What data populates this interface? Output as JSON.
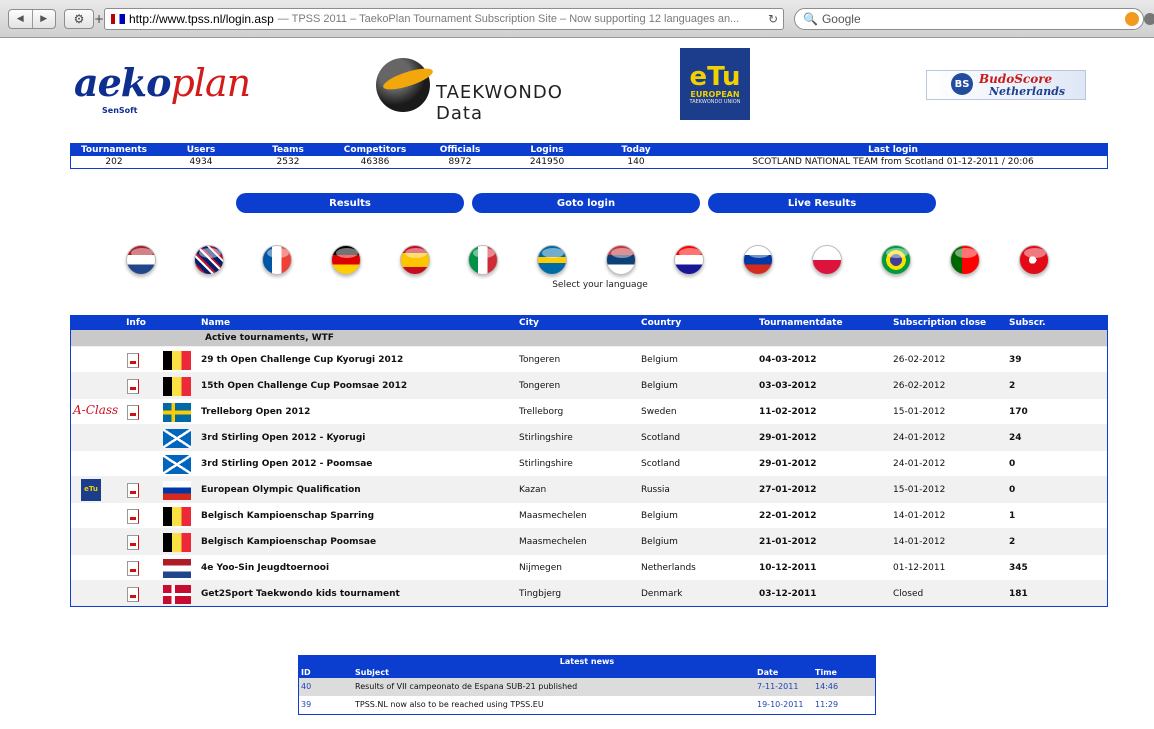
{
  "browser": {
    "url": "http://www.tpss.nl/login.asp",
    "page_title": "— TPSS 2011 – TaekoPlan Tournament Subscription Site – Now supporting 12 languages an...",
    "search_placeholder": "Google",
    "reload_icon": "reload-icon"
  },
  "logos": {
    "taekoplan_main": "aeko",
    "taekoplan_plan": "plan",
    "taekoplan_sub": "SenSoft",
    "taekwondo_data": "TAEKWONDO Data",
    "etu_big": "eTu",
    "etu_small": "EUROPEAN",
    "etu_tiny": "TAEKWONDO UNION",
    "budoscore_mark": "BS",
    "budoscore_name": "BudoScore",
    "budoscore_country": "Netherlands"
  },
  "stats": {
    "headers": [
      "Tournaments",
      "Users",
      "Teams",
      "Competitors",
      "Officials",
      "Logins",
      "Today",
      "Last login"
    ],
    "values": [
      "202",
      "4934",
      "2532",
      "46386",
      "8972",
      "241950",
      "140",
      "SCOTLAND NATIONAL TEAM from Scotland 01-12-2011 / 20:06"
    ]
  },
  "buttons": {
    "results": "Results",
    "goto_login": "Goto login",
    "live_results": "Live Results"
  },
  "languages": {
    "caption": "Select your language",
    "flags": [
      "netherlands",
      "united-kingdom",
      "france",
      "germany",
      "spain",
      "italy",
      "sweden",
      "serbia",
      "croatia",
      "russia",
      "poland",
      "brazil",
      "portugal",
      "turkey"
    ]
  },
  "tournaments": {
    "headers": {
      "info": "Info",
      "name": "Name",
      "city": "City",
      "country": "Country",
      "date": "Tournamentdate",
      "close": "Subscription close",
      "subscr": "Subscr."
    },
    "section": "Active tournaments, WTF",
    "a_class": "A-Class",
    "etu_mini": "eTu",
    "rows": [
      {
        "name": "29 th Open Challenge Cup Kyorugi 2012",
        "city": "Tongeren",
        "country": "Belgium",
        "date": "04-03-2012",
        "close": "26-02-2012",
        "subscr": "39",
        "flag": "belgium"
      },
      {
        "name": "15th Open Challenge Cup Poomsae 2012",
        "city": "Tongeren",
        "country": "Belgium",
        "date": "03-03-2012",
        "close": "26-02-2012",
        "subscr": "2",
        "flag": "belgium"
      },
      {
        "name": "Trelleborg Open 2012",
        "city": "Trelleborg",
        "country": "Sweden",
        "date": "11-02-2012",
        "close": "15-01-2012",
        "subscr": "170",
        "flag": "sweden"
      },
      {
        "name": "3rd Stirling Open 2012 - Kyorugi",
        "city": "Stirlingshire",
        "country": "Scotland",
        "date": "29-01-2012",
        "close": "24-01-2012",
        "subscr": "24",
        "flag": "scotland"
      },
      {
        "name": "3rd Stirling Open 2012 - Poomsae",
        "city": "Stirlingshire",
        "country": "Scotland",
        "date": "29-01-2012",
        "close": "24-01-2012",
        "subscr": "0",
        "flag": "scotland"
      },
      {
        "name": "European Olympic Qualification",
        "city": "Kazan",
        "country": "Russia",
        "date": "27-01-2012",
        "close": "15-01-2012",
        "subscr": "0",
        "flag": "russia"
      },
      {
        "name": "Belgisch Kampioenschap Sparring",
        "city": "Maasmechelen",
        "country": "Belgium",
        "date": "22-01-2012",
        "close": "14-01-2012",
        "subscr": "1",
        "flag": "belgium"
      },
      {
        "name": "Belgisch Kampioenschap Poomsae",
        "city": "Maasmechelen",
        "country": "Belgium",
        "date": "21-01-2012",
        "close": "14-01-2012",
        "subscr": "2",
        "flag": "belgium"
      },
      {
        "name": "4e Yoo-Sin Jeugdtoernooi",
        "city": "Nijmegen",
        "country": "Netherlands",
        "date": "10-12-2011",
        "close": "01-12-2011",
        "subscr": "345",
        "flag": "netherlands"
      },
      {
        "name": "Get2Sport Taekwondo kids tournament",
        "city": "Tingbjerg",
        "country": "Denmark",
        "date": "03-12-2011",
        "close": "Closed",
        "subscr": "181",
        "flag": "denmark"
      }
    ]
  },
  "news": {
    "title": "Latest news",
    "headers": {
      "id": "ID",
      "subject": "Subject",
      "date": "Date",
      "time": "Time"
    },
    "rows": [
      {
        "id": "40",
        "subject": "Results of VII campeonato de Espana SUB-21 published",
        "date": "7-11-2011",
        "time": "14:46"
      },
      {
        "id": "39",
        "subject": "TPSS.NL now also to be reached using TPSS.EU",
        "date": "19-10-2011",
        "time": "11:29"
      }
    ]
  },
  "colors": {
    "accent": "#0b3ecf",
    "section": "#c9c9c9"
  }
}
